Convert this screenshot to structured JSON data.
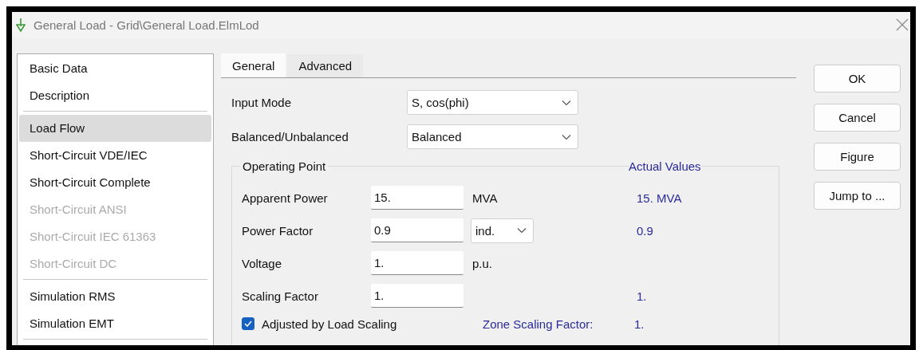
{
  "window": {
    "title": "General Load - Grid\\General Load.ElmLod"
  },
  "sidebar": {
    "groups": [
      [
        {
          "label": "Basic Data",
          "selected": false,
          "disabled": false
        },
        {
          "label": "Description",
          "selected": false,
          "disabled": false
        }
      ],
      [
        {
          "label": "Load Flow",
          "selected": true,
          "disabled": false
        },
        {
          "label": "Short-Circuit VDE/IEC",
          "selected": false,
          "disabled": false
        },
        {
          "label": "Short-Circuit Complete",
          "selected": false,
          "disabled": false
        },
        {
          "label": "Short-Circuit ANSI",
          "selected": false,
          "disabled": true
        },
        {
          "label": "Short-Circuit IEC 61363",
          "selected": false,
          "disabled": true
        },
        {
          "label": "Short-Circuit DC",
          "selected": false,
          "disabled": true
        }
      ],
      [
        {
          "label": "Simulation RMS",
          "selected": false,
          "disabled": false
        },
        {
          "label": "Simulation EMT",
          "selected": false,
          "disabled": false
        }
      ]
    ]
  },
  "tabs": [
    {
      "label": "General",
      "selected": true
    },
    {
      "label": "Advanced",
      "selected": false
    }
  ],
  "form": [
    {
      "label": "Input Mode",
      "value": "S, cos(phi)"
    },
    {
      "label": "Balanced/Unbalanced",
      "value": "Balanced"
    }
  ],
  "operating_point": {
    "title": "Operating Point",
    "actual_title": "Actual Values",
    "rows": [
      {
        "label": "Apparent Power",
        "value": "15.",
        "kind": "unit",
        "unit": "MVA",
        "actual": "15. MVA"
      },
      {
        "label": "Power Factor",
        "value": "0.9",
        "kind": "combo",
        "unit": "ind.",
        "actual": "0.9"
      },
      {
        "label": "Voltage",
        "value": "1.",
        "kind": "unit",
        "unit": "p.u."
      },
      {
        "label": "Scaling Factor",
        "value": "1.",
        "kind": "none",
        "actual": "1."
      }
    ],
    "checkbox": {
      "label": "Adjusted by Load Scaling",
      "checked": true
    },
    "zone_label": "Zone Scaling Factor:",
    "zone_value": "1."
  },
  "buttons": [
    "OK",
    "Cancel",
    "Figure",
    "Jump to ..."
  ]
}
